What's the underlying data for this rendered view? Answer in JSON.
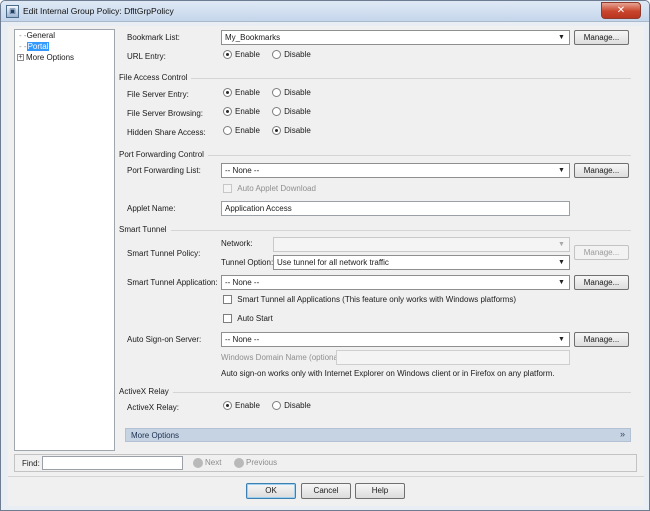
{
  "window": {
    "title": "Edit Internal Group Policy: DfltGrpPolicy",
    "close_glyph": "✕"
  },
  "tree": {
    "items": [
      {
        "label": "General",
        "prefix": "- -"
      },
      {
        "label": "Portal",
        "prefix": "- -",
        "selected": true
      },
      {
        "label": "More Options",
        "expander": "+"
      }
    ]
  },
  "portal": {
    "bookmark_list_label": "Bookmark List:",
    "bookmark_list_value": "My_Bookmarks",
    "url_entry_label": "URL Entry:",
    "manage_label": "Manage...",
    "enable_label": "Enable",
    "disable_label": "Disable",
    "file_access": {
      "section": "File Access Control",
      "server_entry_label": "File Server Entry:",
      "server_browsing_label": "File Server Browsing:",
      "hidden_share_label": "Hidden Share Access:"
    },
    "port_forwarding": {
      "section": "Port Forwarding Control",
      "list_label": "Port Forwarding List:",
      "list_value": "-- None --",
      "auto_applet_label": "Auto Applet Download",
      "applet_name_label": "Applet Name:",
      "applet_name_value": "Application Access"
    },
    "smart_tunnel": {
      "section": "Smart Tunnel",
      "policy_label": "Smart Tunnel Policy:",
      "network_label": "Network:",
      "tunnel_option_label": "Tunnel Option:",
      "tunnel_option_value": "Use tunnel for all network traffic",
      "application_label": "Smart Tunnel Application:",
      "application_value": "-- None --",
      "all_apps_label": "Smart Tunnel all Applications (This feature only works with Windows platforms)",
      "auto_start_label": "Auto Start",
      "auto_signon_label": "Auto Sign-on Server:",
      "auto_signon_value": "-- None --",
      "windows_domain_label": "Windows Domain Name (optional):",
      "signon_note": "Auto sign-on works only with Internet Explorer on Windows client or in Firefox on any platform."
    },
    "activex": {
      "section": "ActiveX Relay",
      "relay_label": "ActiveX Relay:"
    },
    "more_options_label": "More Options",
    "more_options_chevron": "»"
  },
  "find": {
    "label": "Find:",
    "next_label": "Next",
    "previous_label": "Previous"
  },
  "buttons": {
    "ok": "OK",
    "cancel": "Cancel",
    "help": "Help"
  },
  "combo_arrow": "▼"
}
